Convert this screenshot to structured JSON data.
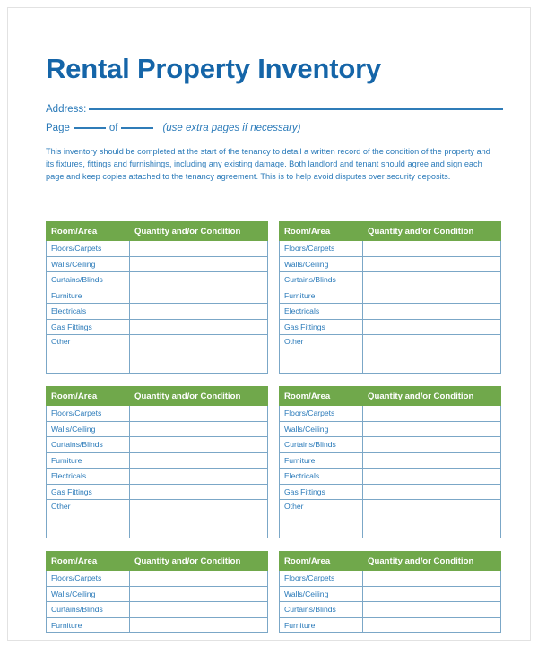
{
  "document": {
    "title": "Rental Property Inventory",
    "address": {
      "label": "Address:",
      "value": ""
    },
    "page_field": {
      "label_page": "Page",
      "label_of": "of",
      "page_number": "",
      "total_pages": "",
      "hint": "(use extra pages if necessary)"
    },
    "intro_paragraph": "This inventory should be completed at the start of the tenancy to detail a written record of the condition of the property and its fixtures, fittings and furnishings, including any existing damage. Both landlord and tenant should agree and sign each page and keep copies attached to the tenancy agreement. This is to help avoid disputes over security deposits."
  },
  "colors": {
    "title_blue": "#1565a8",
    "text_blue": "#2a7ab9",
    "header_green": "#70a84b",
    "cell_border": "#7ba7c7",
    "table_border": "#4a89b8",
    "page_border": "#e2e2e2"
  },
  "table_headers": {
    "room_area": "Room/Area",
    "quantity_condition": "Quantity and/or Condition"
  },
  "row_labels": {
    "floors_carpets": "Floors/Carpets",
    "walls_ceiling": "Walls/Ceiling",
    "curtains_blinds": "Curtains/Blinds",
    "furniture": "Furniture",
    "electricals": "Electricals",
    "gas_fittings": "Gas Fittings",
    "other": "Other"
  },
  "tables": [
    {
      "id": "table-1",
      "position": "row1-left",
      "headers": [
        "Room/Area",
        "Quantity and/or Condition"
      ],
      "rows": [
        {
          "label": "Floors/Carpets",
          "value": ""
        },
        {
          "label": "Walls/Ceiling",
          "value": ""
        },
        {
          "label": "Curtains/Blinds",
          "value": ""
        },
        {
          "label": "Furniture",
          "value": ""
        },
        {
          "label": "Electricals",
          "value": ""
        },
        {
          "label": "Gas Fittings",
          "value": ""
        },
        {
          "label": "Other",
          "value": "",
          "tall": true
        }
      ]
    },
    {
      "id": "table-2",
      "position": "row1-right",
      "headers": [
        "Room/Area",
        "Quantity and/or Condition"
      ],
      "rows": [
        {
          "label": "Floors/Carpets",
          "value": ""
        },
        {
          "label": "Walls/Ceiling",
          "value": ""
        },
        {
          "label": "Curtains/Blinds",
          "value": ""
        },
        {
          "label": "Furniture",
          "value": ""
        },
        {
          "label": "Electricals",
          "value": ""
        },
        {
          "label": "Gas Fittings",
          "value": ""
        },
        {
          "label": "Other",
          "value": "",
          "tall": true
        }
      ]
    },
    {
      "id": "table-3",
      "position": "row2-left",
      "headers": [
        "Room/Area",
        "Quantity and/or Condition"
      ],
      "rows": [
        {
          "label": "Floors/Carpets",
          "value": ""
        },
        {
          "label": "Walls/Ceiling",
          "value": ""
        },
        {
          "label": "Curtains/Blinds",
          "value": ""
        },
        {
          "label": "Furniture",
          "value": ""
        },
        {
          "label": "Electricals",
          "value": ""
        },
        {
          "label": "Gas Fittings",
          "value": ""
        },
        {
          "label": "Other",
          "value": "",
          "tall": true
        }
      ]
    },
    {
      "id": "table-4",
      "position": "row2-right",
      "headers": [
        "Room/Area",
        "Quantity and/or Condition"
      ],
      "rows": [
        {
          "label": "Floors/Carpets",
          "value": ""
        },
        {
          "label": "Walls/Ceiling",
          "value": ""
        },
        {
          "label": "Curtains/Blinds",
          "value": ""
        },
        {
          "label": "Furniture",
          "value": ""
        },
        {
          "label": "Electricals",
          "value": ""
        },
        {
          "label": "Gas Fittings",
          "value": ""
        },
        {
          "label": "Other",
          "value": "",
          "tall": true
        }
      ]
    },
    {
      "id": "table-5",
      "position": "row3-left",
      "headers": [
        "Room/Area",
        "Quantity and/or Condition"
      ],
      "rows": [
        {
          "label": "Floors/Carpets",
          "value": ""
        },
        {
          "label": "Walls/Ceiling",
          "value": ""
        },
        {
          "label": "Curtains/Blinds",
          "value": ""
        },
        {
          "label": "Furniture",
          "value": ""
        }
      ]
    },
    {
      "id": "table-6",
      "position": "row3-right",
      "headers": [
        "Room/Area",
        "Quantity and/or Condition"
      ],
      "rows": [
        {
          "label": "Floors/Carpets",
          "value": ""
        },
        {
          "label": "Walls/Ceiling",
          "value": ""
        },
        {
          "label": "Curtains/Blinds",
          "value": ""
        },
        {
          "label": "Furniture",
          "value": ""
        }
      ]
    }
  ]
}
